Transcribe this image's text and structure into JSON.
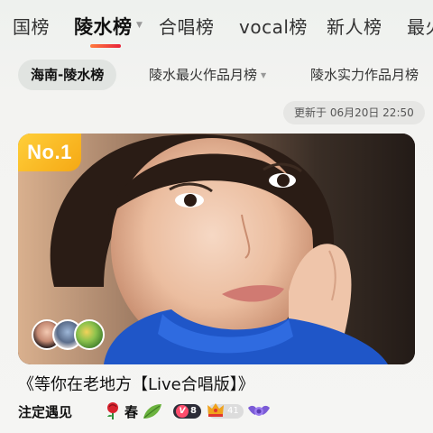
{
  "top_tabs": [
    {
      "label": "国榜",
      "active": false
    },
    {
      "label": "陵水榜",
      "active": true
    },
    {
      "label": "合唱榜",
      "active": false
    },
    {
      "label": "vocal榜",
      "active": false
    },
    {
      "label": "新人榜",
      "active": false
    },
    {
      "label": "最火",
      "active": false
    }
  ],
  "sub_tabs": [
    {
      "label": "海南-陵水榜",
      "active": true
    },
    {
      "label": "陵水最火作品月榜",
      "active": false
    },
    {
      "label": "陵水实力作品月榜",
      "active": false
    }
  ],
  "update_text": "更新于 06月20日 22:50",
  "card": {
    "rank_label": "No.1"
  },
  "song": {
    "title": "《等你在老地方【Live合唱版】》",
    "author_prefix": "注定遇见",
    "author_suffix": "春",
    "vip_level": "8",
    "fan_level": "41"
  },
  "colors": {
    "accent_underline": "#e8233a",
    "rank_badge": "#f7b31f"
  }
}
